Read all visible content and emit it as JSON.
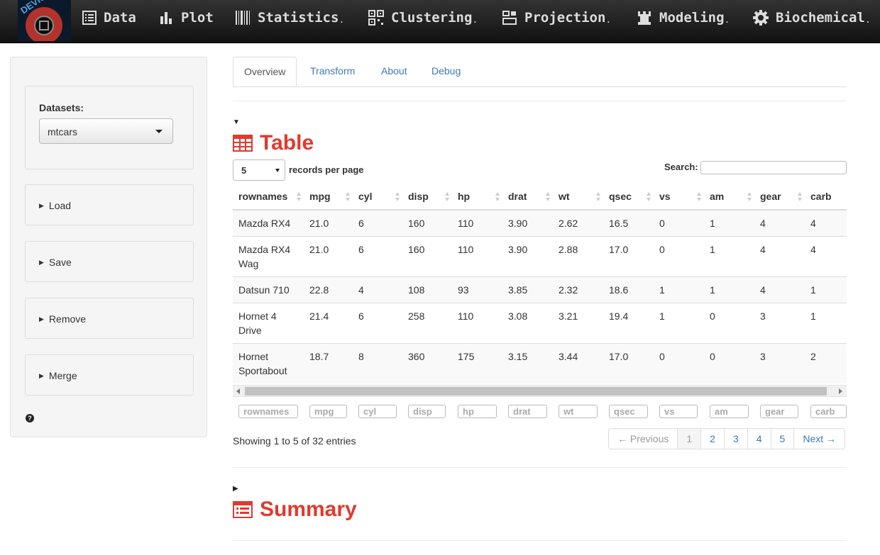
{
  "app": {
    "logo_text": "DEVIUM"
  },
  "navbar": {
    "items": [
      {
        "label": "Data",
        "icon": "list-icon",
        "dropdown": false
      },
      {
        "label": "Plot",
        "icon": "bar-chart-icon",
        "dropdown": false
      },
      {
        "label": "Statistics",
        "icon": "barcode-icon",
        "dropdown": true
      },
      {
        "label": "Clustering",
        "icon": "qrcode-icon",
        "dropdown": true
      },
      {
        "label": "Projection",
        "icon": "fullscreen-icon",
        "dropdown": true
      },
      {
        "label": "Modeling",
        "icon": "tower-icon",
        "dropdown": true
      },
      {
        "label": "Biochemical",
        "icon": "gear-icon",
        "dropdown": true
      }
    ],
    "caret": "."
  },
  "sidebar": {
    "datasets_label": "Datasets:",
    "dataset_selected": "mtcars",
    "sections": [
      {
        "label": "Load"
      },
      {
        "label": "Save"
      },
      {
        "label": "Remove"
      },
      {
        "label": "Merge"
      }
    ],
    "help_glyph": "?"
  },
  "tabs": [
    {
      "label": "Overview",
      "active": true
    },
    {
      "label": "Transform",
      "active": false
    },
    {
      "label": "About",
      "active": false
    },
    {
      "label": "Debug",
      "active": false
    }
  ],
  "table_section": {
    "title": "Table",
    "expanded": true,
    "page_length": "5",
    "records_label": "records per page",
    "search_label": "Search:",
    "search_value": "",
    "columns": [
      "rownames",
      "mpg",
      "cyl",
      "disp",
      "hp",
      "drat",
      "wt",
      "qsec",
      "vs",
      "am",
      "gear",
      "carb"
    ],
    "rows": [
      [
        "Mazda RX4",
        "21.0",
        "6",
        "160",
        "110",
        "3.90",
        "2.62",
        "16.5",
        "0",
        "1",
        "4",
        "4"
      ],
      [
        "Mazda RX4 Wag",
        "21.0",
        "6",
        "160",
        "110",
        "3.90",
        "2.88",
        "17.0",
        "0",
        "1",
        "4",
        "4"
      ],
      [
        "Datsun 710",
        "22.8",
        "4",
        "108",
        "93",
        "3.85",
        "2.32",
        "18.6",
        "1",
        "1",
        "4",
        "1"
      ],
      [
        "Hornet 4 Drive",
        "21.4",
        "6",
        "258",
        "110",
        "3.08",
        "3.21",
        "19.4",
        "1",
        "0",
        "3",
        "1"
      ],
      [
        "Hornet Sportabout",
        "18.7",
        "8",
        "360",
        "175",
        "3.15",
        "3.44",
        "17.0",
        "0",
        "0",
        "3",
        "2"
      ]
    ],
    "info": "Showing 1 to 5 of 32 entries",
    "pagination": {
      "previous": "← Previous",
      "pages": [
        "1",
        "2",
        "3",
        "4",
        "5"
      ],
      "current": "1",
      "next": "Next →"
    }
  },
  "summary_section": {
    "title": "Summary",
    "expanded": false
  },
  "colors": {
    "accent_red": "#e03a2e",
    "link_blue": "#3a7ab8",
    "navbar_bg": "#1a1a1a"
  }
}
